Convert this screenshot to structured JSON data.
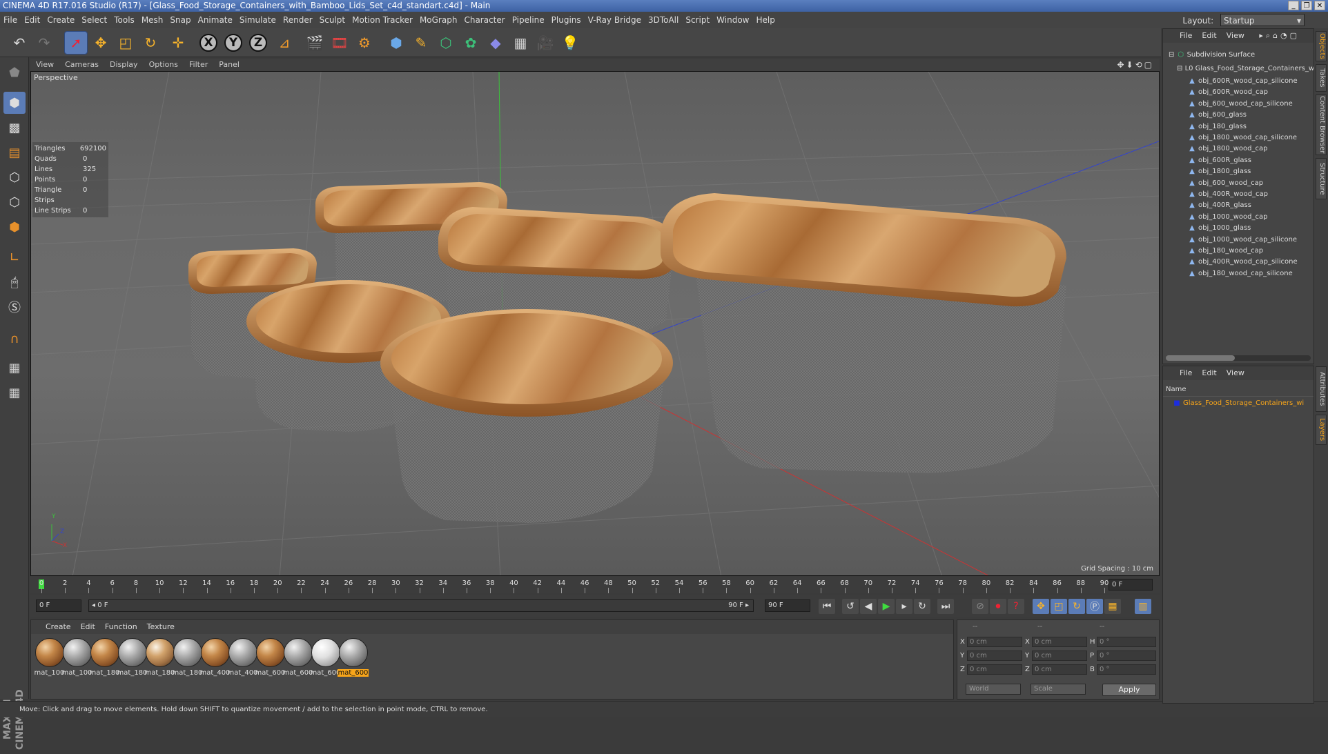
{
  "app": {
    "title": "CINEMA 4D R17.016 Studio (R17) - [Glass_Food_Storage_Containers_with_Bamboo_Lids_Set_c4d_standart.c4d] - Main",
    "window_buttons": [
      "_",
      "❐",
      "✕"
    ]
  },
  "menubar": {
    "items": [
      "File",
      "Edit",
      "Create",
      "Select",
      "Tools",
      "Mesh",
      "Snap",
      "Animate",
      "Simulate",
      "Render",
      "Sculpt",
      "Motion Tracker",
      "MoGraph",
      "Character",
      "Pipeline",
      "Plugins",
      "V-Ray Bridge",
      "3DToAll",
      "Script",
      "Window",
      "Help"
    ],
    "layout_label": "Layout:",
    "layout_value": "Startup"
  },
  "toolbar": {
    "icons": [
      "undo-icon",
      "redo-icon",
      "live-selection-icon",
      "move-icon",
      "scale-icon",
      "rotate-icon",
      "last-tool-icon",
      "x-axis-icon",
      "y-axis-icon",
      "z-axis-icon",
      "coordinate-system-icon",
      "render-view-icon",
      "render-picture-viewer-icon",
      "edit-render-settings-icon",
      "cube-icon",
      "pen-icon",
      "subdivision-icon",
      "cloner-icon",
      "deformer-icon",
      "floor-icon",
      "camera-icon",
      "light-icon"
    ],
    "axis_labels": [
      "X",
      "Y",
      "Z"
    ]
  },
  "viewport": {
    "menu": [
      "View",
      "Cameras",
      "Display",
      "Options",
      "Filter",
      "Panel"
    ],
    "label": "Perspective",
    "stats": [
      {
        "k": "Triangles",
        "v": "692100"
      },
      {
        "k": "Quads",
        "v": "0"
      },
      {
        "k": "Lines",
        "v": "325"
      },
      {
        "k": "Points",
        "v": "0"
      },
      {
        "k": "Triangle Strips",
        "v": "0"
      },
      {
        "k": "Line Strips",
        "v": "0"
      }
    ],
    "grid_spacing": "Grid Spacing : 10 cm",
    "axis_letters": [
      "Y",
      "X",
      "Z"
    ]
  },
  "timeline": {
    "ticks": [
      "0",
      "2",
      "4",
      "6",
      "8",
      "10",
      "12",
      "14",
      "16",
      "18",
      "20",
      "22",
      "24",
      "26",
      "28",
      "30",
      "32",
      "34",
      "36",
      "38",
      "40",
      "42",
      "44",
      "46",
      "48",
      "50",
      "52",
      "54",
      "56",
      "58",
      "60",
      "62",
      "64",
      "66",
      "68",
      "70",
      "72",
      "74",
      "76",
      "78",
      "80",
      "82",
      "84",
      "86",
      "88",
      "90"
    ],
    "current_frame": "0 F",
    "start_field": "0 F",
    "range_start": "◂ 0 F",
    "range_end": "90 F ▸",
    "end_field": "90 F"
  },
  "materials": {
    "menu": [
      "Create",
      "Edit",
      "Function",
      "Texture"
    ],
    "items": [
      {
        "label": "mat_100",
        "kind": "wood"
      },
      {
        "label": "mat_100",
        "kind": "glass"
      },
      {
        "label": "mat_180",
        "kind": "wood"
      },
      {
        "label": "mat_180",
        "kind": "glass"
      },
      {
        "label": "mat_180",
        "kind": "wg"
      },
      {
        "label": "mat_180",
        "kind": "glass"
      },
      {
        "label": "mat_400",
        "kind": "wood"
      },
      {
        "label": "mat_400",
        "kind": "glass"
      },
      {
        "label": "mat_600",
        "kind": "wood"
      },
      {
        "label": "mat_600",
        "kind": "glass"
      },
      {
        "label": "mat_600",
        "kind": "white"
      },
      {
        "label": "mat_600",
        "kind": "glass",
        "selected": true
      }
    ],
    "brand": "MAXON CINEMA 4D"
  },
  "coords": {
    "headers": [
      "--",
      "--",
      "--"
    ],
    "rows": [
      {
        "a": "X",
        "av": "0 cm",
        "b": "X",
        "bv": "0 cm",
        "c": "H",
        "cv": "0 °"
      },
      {
        "a": "Y",
        "av": "0 cm",
        "b": "Y",
        "bv": "0 cm",
        "c": "P",
        "cv": "0 °"
      },
      {
        "a": "Z",
        "av": "0 cm",
        "b": "Z",
        "bv": "0 cm",
        "c": "B",
        "cv": "0 °"
      }
    ],
    "space": "World",
    "mode": "Scale",
    "apply": "Apply"
  },
  "object_manager": {
    "menu": [
      "File",
      "Edit",
      "View"
    ],
    "root": "Subdivision Surface",
    "group": "Glass_Food_Storage_Containers_w",
    "items": [
      "obj_600R_wood_cap_silicone",
      "obj_600R_wood_cap",
      "obj_600_wood_cap_silicone",
      "obj_600_glass",
      "obj_180_glass",
      "obj_1800_wood_cap_silicone",
      "obj_1800_wood_cap",
      "obj_600R_glass",
      "obj_1800_glass",
      "obj_600_wood_cap",
      "obj_400R_wood_cap",
      "obj_400R_glass",
      "obj_1000_wood_cap",
      "obj_1000_glass",
      "obj_1000_wood_cap_silicone",
      "obj_180_wood_cap",
      "obj_400R_wood_cap_silicone",
      "obj_180_wood_cap_silicone"
    ]
  },
  "layer_manager": {
    "menu": [
      "File",
      "Edit",
      "View"
    ],
    "name_header": "Name",
    "layer": "Glass_Food_Storage_Containers_wi"
  },
  "side_tabs": [
    "Objects",
    "Takes",
    "Content Browser",
    "Structure",
    "Attributes",
    "Layers"
  ],
  "status": "Move: Click and drag to move elements. Hold down SHIFT to quantize movement / add to the selection in point mode, CTRL to remove.",
  "colors": {
    "accent": "#5b7cb7",
    "selected_material": "#f7a51a",
    "wood": "#c38648",
    "playhead": "#3fdc3f"
  }
}
